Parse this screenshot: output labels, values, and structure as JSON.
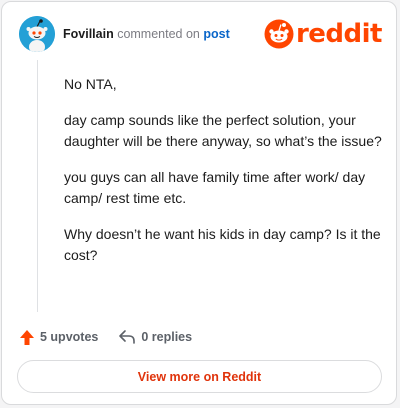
{
  "comment": {
    "author": "Fovillain",
    "action_text": "commented on",
    "post_link_text": "post",
    "paragraphs": [
      "No NTA,",
      "day camp sounds like the perfect solution, your daughter will be there anyway, so what’s the issue?",
      "you guys can all have family time after work/ day camp/ rest time etc.",
      "Why doesn’t he want his kids in day camp? Is it the cost?"
    ]
  },
  "brand": {
    "wordmark": "reddit",
    "color": "#ff4500"
  },
  "stats": {
    "upvotes_label": "5 upvotes",
    "replies_label": "0 replies",
    "upvote_icon": "upvote-arrow-icon",
    "reply_icon": "reply-arrow-icon"
  },
  "cta": {
    "label": "View more on Reddit"
  },
  "colors": {
    "accent": "#ff4500",
    "link": "#0a66c9",
    "avatar_bg": "#24a0d6"
  }
}
